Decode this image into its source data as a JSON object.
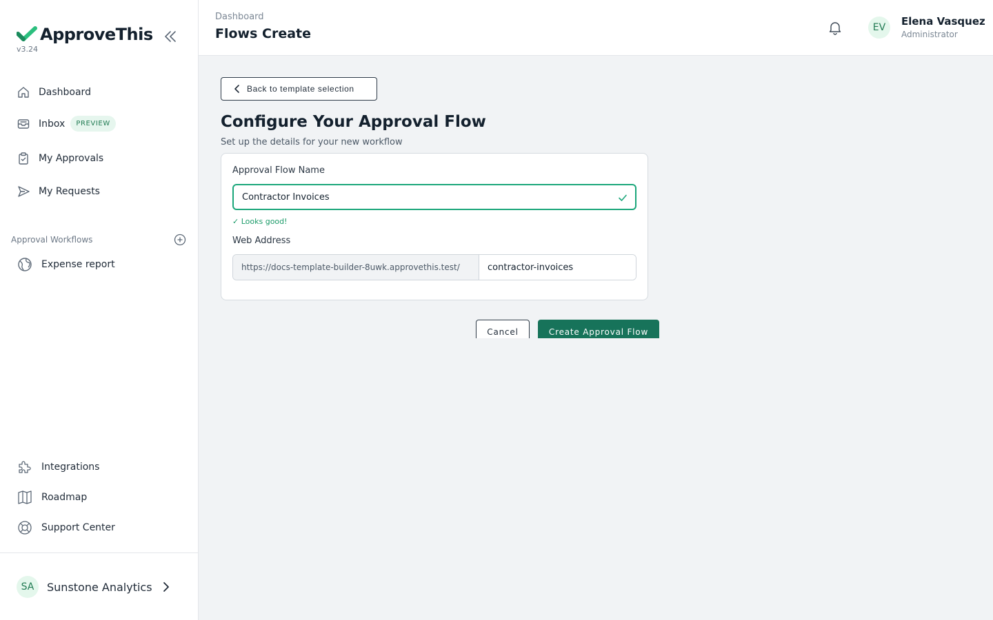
{
  "app": {
    "name": "ApproveThis",
    "version": "v3.24",
    "brand_color": "#17735a",
    "accent_color": "#1aa67a"
  },
  "sidebar": {
    "nav": [
      {
        "label": "Dashboard",
        "icon": "home-icon"
      },
      {
        "label": "Inbox",
        "icon": "inbox-icon",
        "badge": "PREVIEW"
      },
      {
        "label": "My Approvals",
        "icon": "clipboard-icon"
      },
      {
        "label": "My Requests",
        "icon": "send-icon"
      }
    ],
    "workflows_title": "Approval Workflows",
    "workflows": [
      {
        "label": "Expense report",
        "icon": "globe-icon"
      }
    ],
    "bottom": [
      {
        "label": "Integrations",
        "icon": "puzzle-icon"
      },
      {
        "label": "Roadmap",
        "icon": "map-icon"
      },
      {
        "label": "Support Center",
        "icon": "lifebuoy-icon"
      }
    ],
    "org": {
      "initials": "SA",
      "name": "Sunstone Analytics"
    }
  },
  "header": {
    "breadcrumb": "Dashboard",
    "title": "Flows Create",
    "user": {
      "initials": "EV",
      "name": "Elena Vasquez",
      "role": "Administrator"
    }
  },
  "main": {
    "back_label": "Back to template selection",
    "heading": "Configure Your Approval Flow",
    "subheading": "Set up the details for your new workflow",
    "form": {
      "name_label": "Approval Flow Name",
      "name_value": "Contractor Invoices",
      "validation": "✓ Looks good!",
      "web_label": "Web Address",
      "url_prefix": "https://docs-template-builder-8uwk.approvethis.test/",
      "url_slug": "contractor-invoices"
    },
    "cancel_label": "Cancel",
    "create_label": "Create Approval Flow"
  }
}
